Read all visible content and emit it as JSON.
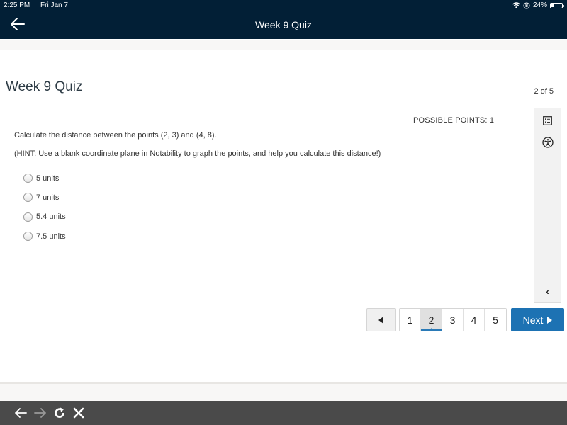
{
  "status_bar": {
    "time": "2:25 PM",
    "date": "Fri Jan 7",
    "battery": "24%",
    "icons": [
      "wifi-icon",
      "orientation-lock-icon",
      "battery-icon"
    ]
  },
  "nav": {
    "title": "Week 9 Quiz",
    "back_icon": "arrow-left-icon"
  },
  "quiz": {
    "title": "Week 9 Quiz",
    "question_count": "2 of 5",
    "possible_points": "POSSIBLE POINTS: 1",
    "question_text": "Calculate the distance between the points (2, 3) and (4, 8).",
    "hint_text": "(HINT:  Use a blank coordinate plane in Notability to graph the points, and help you calculate this distance!)",
    "answers": [
      {
        "label": "5 units",
        "selected": false
      },
      {
        "label": "7 units",
        "selected": false
      },
      {
        "label": "5.4 units",
        "selected": false
      },
      {
        "label": "7.5 units",
        "selected": false
      }
    ]
  },
  "side_panel": {
    "icons": [
      "question-list-icon",
      "accessibility-icon"
    ],
    "collapse_icon": "chevron-left-icon",
    "collapse_label": "‹"
  },
  "pagination": {
    "prev_icon": "triangle-left-icon",
    "pages": [
      "1",
      "2",
      "3",
      "4",
      "5"
    ],
    "current_page": "2",
    "next_label": "Next"
  },
  "browser_bar": {
    "icons": [
      "back-arrow-icon",
      "forward-arrow-icon",
      "reload-icon",
      "close-icon"
    ]
  },
  "colors": {
    "header_bg": "#021f36",
    "accent": "#1d72b3",
    "browser_bar_bg": "#4a4a4a"
  }
}
